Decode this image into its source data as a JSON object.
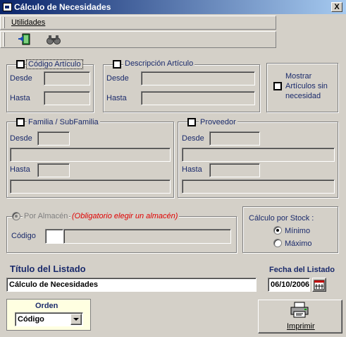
{
  "window": {
    "title": "Cálculo de Necesidades",
    "close": "X"
  },
  "menu": {
    "utilidades": "Utilidades"
  },
  "toolbar": {
    "icons": [
      "exit-door-icon",
      "binoculars-icon"
    ]
  },
  "codigo_articulo": {
    "title": "Código Artículo",
    "desde": "Desde",
    "hasta": "Hasta"
  },
  "descripcion_articulo": {
    "title": "Descripción Artículo",
    "desde": "Desde",
    "hasta": "Hasta"
  },
  "mostrar": {
    "line1": "Mostrar",
    "line2": "Artículos sin",
    "line3": "necesidad"
  },
  "familia": {
    "title": "Familia / SubFamilia",
    "desde": "Desde",
    "hasta": "Hasta"
  },
  "proveedor": {
    "title": "Proveedor",
    "desde": "Desde",
    "hasta": "Hasta"
  },
  "almacen": {
    "radio_label": "Por Almacén",
    "note": "(Obligatorio elegir un almacén)",
    "codigo": "Código"
  },
  "stock": {
    "title": "Cálculo por Stock :",
    "minimo": "Mínimo",
    "maximo": "Máximo"
  },
  "titulo": {
    "label": "Título del Listado",
    "value": "Cálculo de Necesidades"
  },
  "fecha": {
    "label": "Fecha del Listado",
    "value": "06/10/2006"
  },
  "orden": {
    "label": "Orden",
    "value": "Código"
  },
  "imprimir": {
    "label": "Imprimir"
  },
  "colors": {
    "title_start": "#0a246a",
    "title_end": "#a6caf0",
    "label": "#1a2a6b",
    "note": "#e00000",
    "orden_bg": "#ffffe1"
  }
}
